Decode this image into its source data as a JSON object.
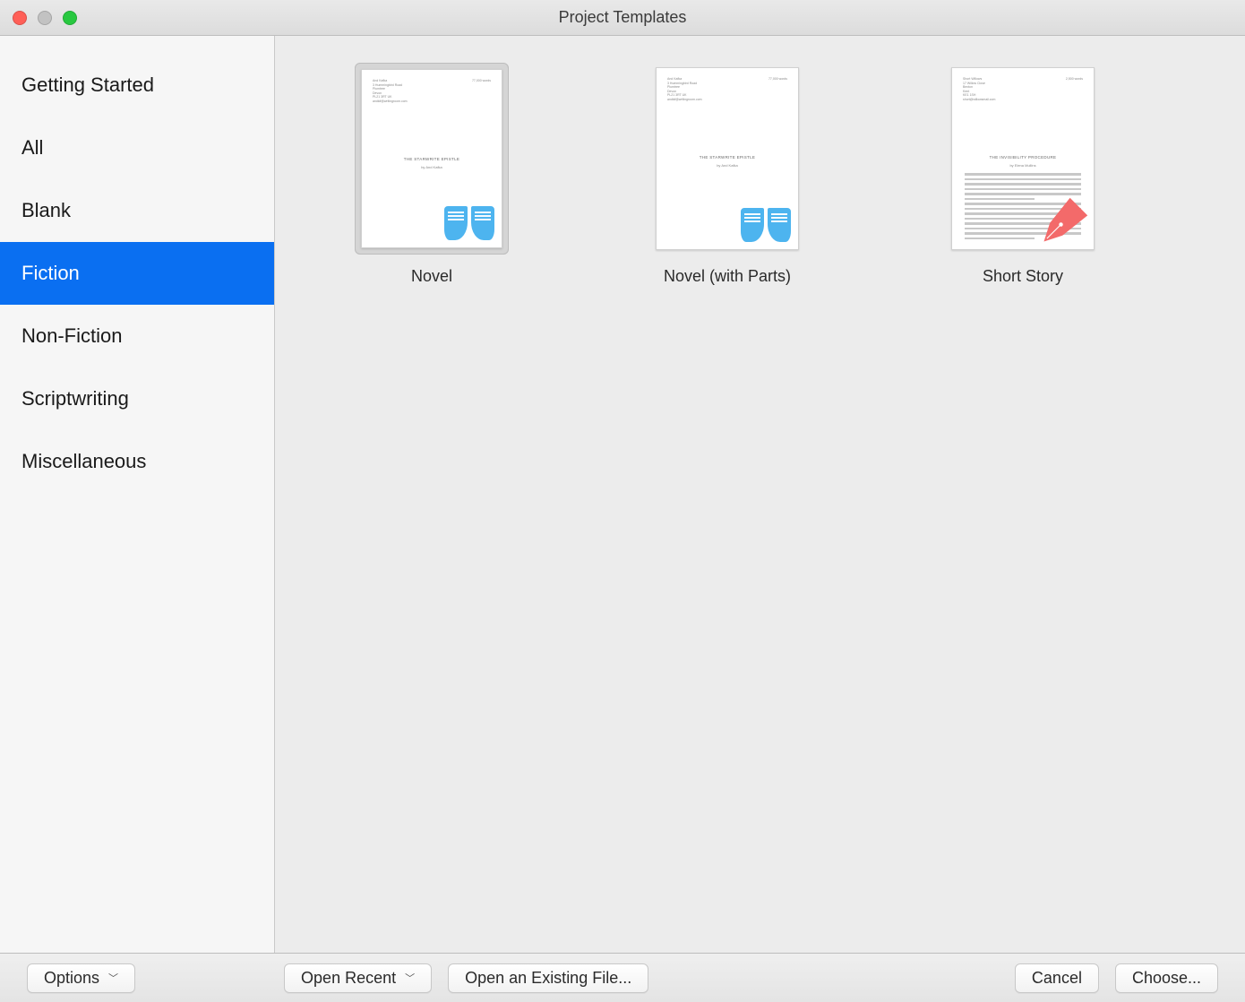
{
  "window": {
    "title": "Project Templates"
  },
  "sidebar": {
    "items": [
      {
        "label": "Getting Started",
        "selected": false
      },
      {
        "label": "All",
        "selected": false
      },
      {
        "label": "Blank",
        "selected": false
      },
      {
        "label": "Fiction",
        "selected": true
      },
      {
        "label": "Non-Fiction",
        "selected": false
      },
      {
        "label": "Scriptwriting",
        "selected": false
      },
      {
        "label": "Miscellaneous",
        "selected": false
      }
    ]
  },
  "templates": [
    {
      "label": "Novel",
      "icon": "book",
      "selected": true
    },
    {
      "label": "Novel (with Parts)",
      "icon": "book",
      "selected": false
    },
    {
      "label": "Short Story",
      "icon": "pen",
      "selected": false
    }
  ],
  "toolbar": {
    "options_label": "Options",
    "open_recent_label": "Open Recent",
    "open_existing_label": "Open an Existing File...",
    "cancel_label": "Cancel",
    "choose_label": "Choose..."
  },
  "colors": {
    "selection": "#0a6ff1",
    "book_icon": "#4db4ef",
    "pen_icon": "#f36a6a"
  }
}
